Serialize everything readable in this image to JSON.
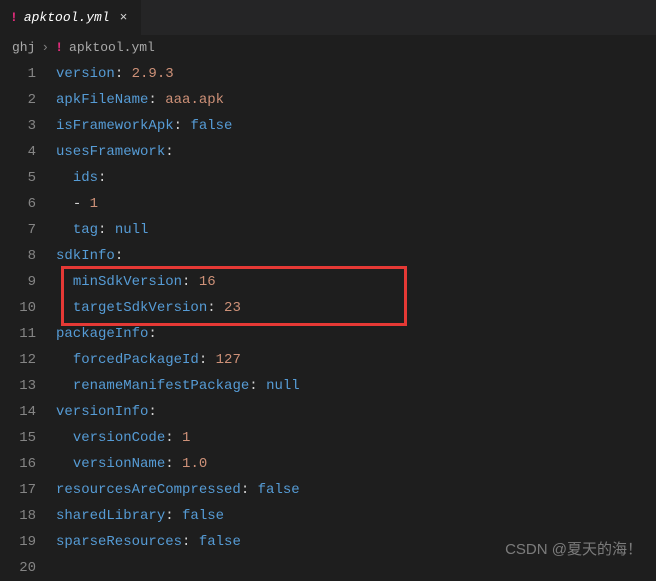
{
  "tab": {
    "filename": "apktool.yml",
    "close": "×"
  },
  "breadcrumb": {
    "folder": "ghj",
    "chev": "›",
    "file": "apktool.yml"
  },
  "code": {
    "lines": [
      {
        "n": 1,
        "segs": [
          {
            "t": "version",
            "c": "k"
          },
          {
            "t": ": ",
            "c": "p"
          },
          {
            "t": "2.9.3",
            "c": "s"
          }
        ]
      },
      {
        "n": 2,
        "segs": [
          {
            "t": "apkFileName",
            "c": "k"
          },
          {
            "t": ": ",
            "c": "p"
          },
          {
            "t": "aaa.apk",
            "c": "s"
          }
        ]
      },
      {
        "n": 3,
        "segs": [
          {
            "t": "isFrameworkApk",
            "c": "k"
          },
          {
            "t": ": ",
            "c": "p"
          },
          {
            "t": "false",
            "c": "v"
          }
        ]
      },
      {
        "n": 4,
        "segs": [
          {
            "t": "usesFramework",
            "c": "k"
          },
          {
            "t": ":",
            "c": "p"
          }
        ]
      },
      {
        "n": 5,
        "indent": 1,
        "segs": [
          {
            "t": "ids",
            "c": "k"
          },
          {
            "t": ":",
            "c": "p"
          }
        ]
      },
      {
        "n": 6,
        "indent": 1,
        "segs": [
          {
            "t": "- ",
            "c": "dash"
          },
          {
            "t": "1",
            "c": "s"
          }
        ]
      },
      {
        "n": 7,
        "indent": 1,
        "segs": [
          {
            "t": "tag",
            "c": "k"
          },
          {
            "t": ": ",
            "c": "p"
          },
          {
            "t": "null",
            "c": "v"
          }
        ]
      },
      {
        "n": 8,
        "segs": [
          {
            "t": "sdkInfo",
            "c": "k"
          },
          {
            "t": ":",
            "c": "p"
          }
        ]
      },
      {
        "n": 9,
        "indent": 1,
        "segs": [
          {
            "t": "minSdkVersion",
            "c": "k"
          },
          {
            "t": ": ",
            "c": "p"
          },
          {
            "t": "16",
            "c": "s"
          }
        ]
      },
      {
        "n": 10,
        "indent": 1,
        "segs": [
          {
            "t": "targetSdkVersion",
            "c": "k"
          },
          {
            "t": ": ",
            "c": "p"
          },
          {
            "t": "23",
            "c": "s"
          }
        ]
      },
      {
        "n": 11,
        "segs": [
          {
            "t": "packageInfo",
            "c": "k"
          },
          {
            "t": ":",
            "c": "p"
          }
        ]
      },
      {
        "n": 12,
        "indent": 1,
        "segs": [
          {
            "t": "forcedPackageId",
            "c": "k"
          },
          {
            "t": ": ",
            "c": "p"
          },
          {
            "t": "127",
            "c": "s"
          }
        ]
      },
      {
        "n": 13,
        "indent": 1,
        "segs": [
          {
            "t": "renameManifestPackage",
            "c": "k"
          },
          {
            "t": ": ",
            "c": "p"
          },
          {
            "t": "null",
            "c": "v"
          }
        ]
      },
      {
        "n": 14,
        "segs": [
          {
            "t": "versionInfo",
            "c": "k"
          },
          {
            "t": ":",
            "c": "p"
          }
        ]
      },
      {
        "n": 15,
        "indent": 1,
        "segs": [
          {
            "t": "versionCode",
            "c": "k"
          },
          {
            "t": ": ",
            "c": "p"
          },
          {
            "t": "1",
            "c": "s"
          }
        ]
      },
      {
        "n": 16,
        "indent": 1,
        "segs": [
          {
            "t": "versionName",
            "c": "k"
          },
          {
            "t": ": ",
            "c": "p"
          },
          {
            "t": "1.0",
            "c": "s"
          }
        ]
      },
      {
        "n": 17,
        "segs": [
          {
            "t": "resourcesAreCompressed",
            "c": "k"
          },
          {
            "t": ": ",
            "c": "p"
          },
          {
            "t": "false",
            "c": "v"
          }
        ]
      },
      {
        "n": 18,
        "segs": [
          {
            "t": "sharedLibrary",
            "c": "k"
          },
          {
            "t": ": ",
            "c": "p"
          },
          {
            "t": "false",
            "c": "v"
          }
        ]
      },
      {
        "n": 19,
        "segs": [
          {
            "t": "sparseResources",
            "c": "k"
          },
          {
            "t": ": ",
            "c": "p"
          },
          {
            "t": "false",
            "c": "v"
          }
        ]
      },
      {
        "n": 20,
        "segs": []
      }
    ]
  },
  "watermark": "CSDN @夏天的海！"
}
